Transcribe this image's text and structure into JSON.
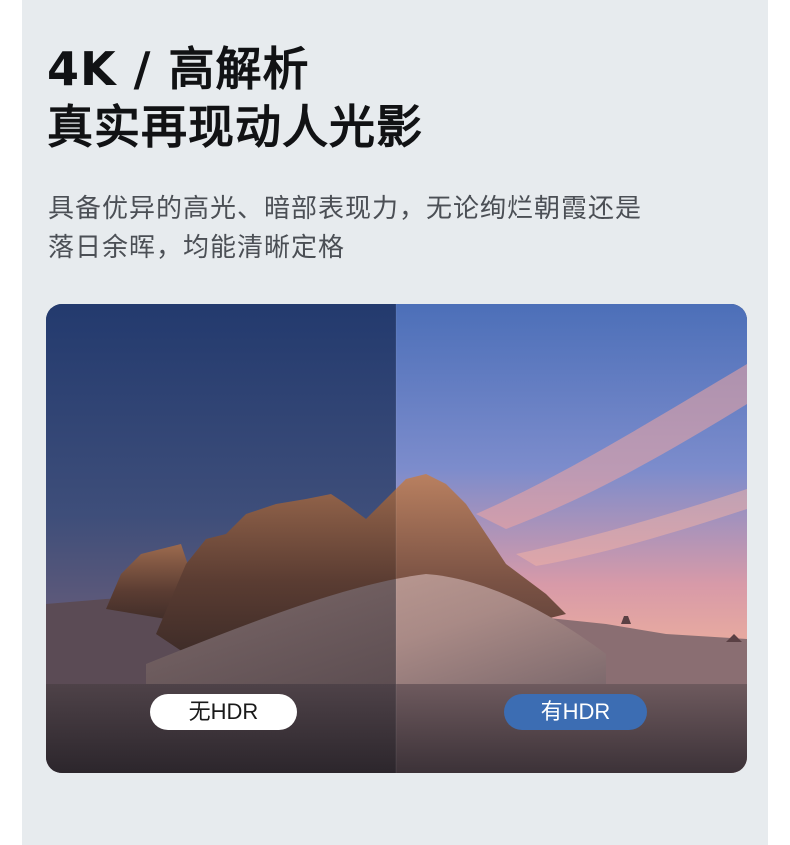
{
  "headline": {
    "line1": "4K / 高解析",
    "line2": "真实再现动人光影"
  },
  "description": {
    "line1": "具备优异的高光、暗部表现力，无论绚烂朝霞还是",
    "line2": "落日余晖，均能清晰定格"
  },
  "comparison": {
    "left_label": "无HDR",
    "right_label": "有HDR",
    "image_subject": "desert-rock-formation-at-dusk"
  }
}
